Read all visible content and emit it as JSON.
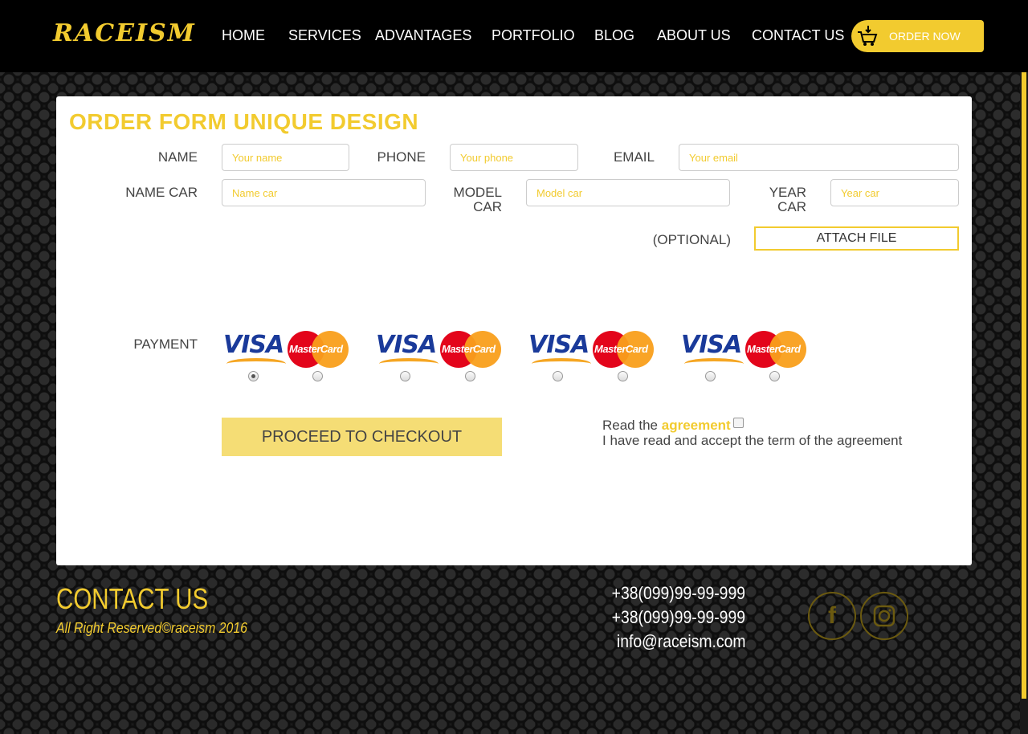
{
  "header": {
    "logo": "RACEISM",
    "nav": [
      "HOME",
      "SERVICES",
      "ADVANTAGES",
      "PORTFOLIO",
      "BLOG",
      "ABOUT US",
      "CONTACT US"
    ],
    "order_button": "ORDER NOW"
  },
  "form": {
    "title": "ORDER FORM UNIQUE DESIGN",
    "labels": {
      "name": "NAME",
      "phone": "PHONE",
      "email": "EMAIL",
      "name_car": "NAME CAR",
      "model_car": "MODEL CAR",
      "year_car": "YEAR CAR",
      "optional": "(OPTIONAL)",
      "payment": "PAYMENT"
    },
    "placeholders": {
      "name": "Your name",
      "phone": "Your phone",
      "email": "Your email",
      "name_car": "Name car",
      "model_car": "Model car",
      "year_car": "Year car"
    },
    "attach_button": "ATTACH FILE",
    "payment_options": [
      {
        "visa": "VISA",
        "mastercard": "MasterCard",
        "visa_selected": true,
        "mastercard_selected": false
      },
      {
        "visa": "VISA",
        "mastercard": "MasterCard",
        "visa_selected": false,
        "mastercard_selected": false
      },
      {
        "visa": "VISA",
        "mastercard": "MasterCard",
        "visa_selected": false,
        "mastercard_selected": false
      },
      {
        "visa": "VISA",
        "mastercard": "MasterCard",
        "visa_selected": false,
        "mastercard_selected": false
      }
    ],
    "checkout_button": "PROCEED TO CHECKOUT",
    "agreement": {
      "prefix": "Read the",
      "link": "agreement",
      "text": "I have read and accept the term of the agreement",
      "checked": false
    }
  },
  "footer": {
    "title": "CONTACT US",
    "rights": "All Right Reserved©raceism 2016",
    "phone1": "+38(099)99-99-999",
    "phone2": "+38(099)99-99-999",
    "email": "info@raceism.com",
    "social": [
      "facebook-icon",
      "instagram-icon"
    ]
  },
  "colors": {
    "accent": "#f2cb2f",
    "checkout_bg": "#f5dd75",
    "header_bg": "#000000"
  }
}
